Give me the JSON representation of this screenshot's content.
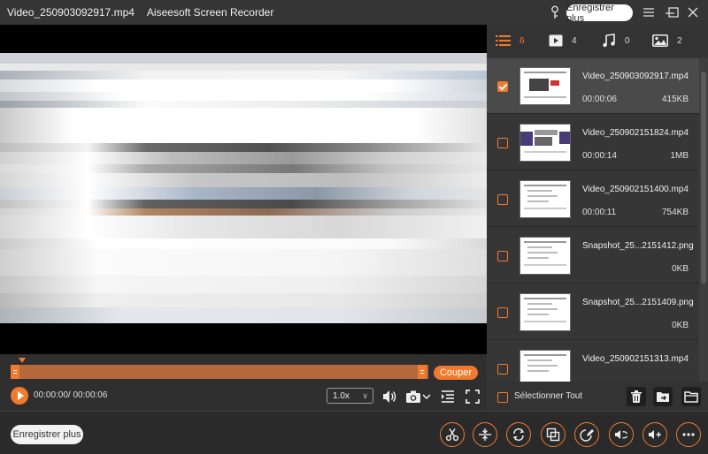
{
  "window": {
    "file_title": "Video_250903092917.mp4",
    "app_name": "Aiseesoft Screen Recorder",
    "register_label": "Enregistrer plus"
  },
  "timeline": {
    "cut_label": "Couper"
  },
  "controls": {
    "timecode": "00:00:00/ 00:00:06",
    "speed": "1.0x"
  },
  "tabs": [
    {
      "name": "all",
      "count": "6",
      "icon": "list-icon"
    },
    {
      "name": "video",
      "count": "4",
      "icon": "video-icon"
    },
    {
      "name": "audio",
      "count": "0",
      "icon": "music-icon"
    },
    {
      "name": "image",
      "count": "2",
      "icon": "image-icon"
    }
  ],
  "files": [
    {
      "name": "Video_250903092917.mp4",
      "duration": "00:00:06",
      "size": "415KB",
      "checked": true
    },
    {
      "name": "Video_250902151824.mp4",
      "duration": "00:00:14",
      "size": "1MB",
      "checked": false
    },
    {
      "name": "Video_250902151400.mp4",
      "duration": "00:00:11",
      "size": "754KB",
      "checked": false
    },
    {
      "name": "Snapshot_25...2151412.png",
      "duration": "",
      "size": "0KB",
      "checked": false
    },
    {
      "name": "Snapshot_25...2151409.png",
      "duration": "",
      "size": "0KB",
      "checked": false
    },
    {
      "name": "Video_250902151313.mp4",
      "duration": "",
      "size": "",
      "checked": false
    }
  ],
  "panel": {
    "select_all_label": "Sélectionner Tout"
  },
  "bottom": {
    "register_label": "Enregistrer plus"
  },
  "colors": {
    "accent": "#f07a2e",
    "background": "#2f2f2f"
  }
}
